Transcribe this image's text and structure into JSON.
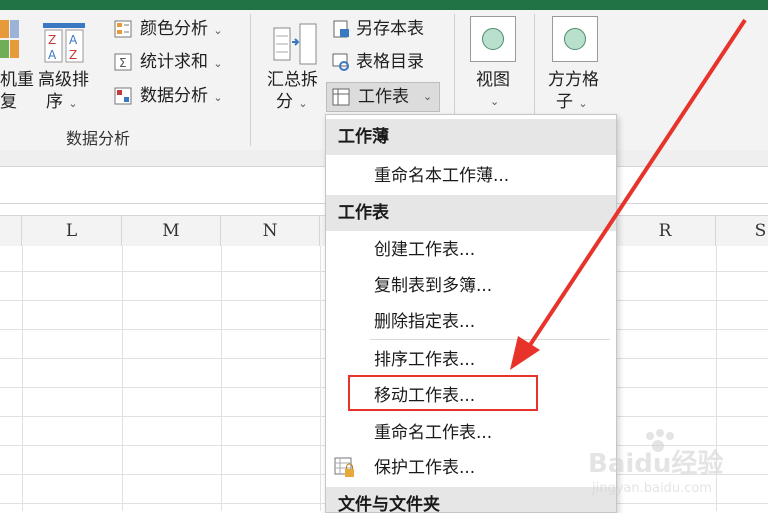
{
  "ribbon": {
    "left_cut_1": "机重",
    "left_cut_2": "复",
    "sort": {
      "line1": "高级排",
      "line2": "序"
    },
    "color_analysis": "颜色分析",
    "stat_sum": "统计求和",
    "data_analysis": "数据分析",
    "group_label": "数据分析",
    "summary_split": {
      "line1": "汇总拆",
      "line2": "分"
    },
    "save_copy": "另存本表",
    "table_dir": "表格目录",
    "worksheet": "工作表",
    "view": "视图",
    "fangfang": {
      "line1": "方方格",
      "line2": "子"
    }
  },
  "columns": [
    "L",
    "M",
    "N",
    "R",
    "S"
  ],
  "menu": {
    "section_workbook": "工作薄",
    "rename_workbook": "重命名本工作薄...",
    "section_worksheet": "工作表",
    "create_sheet": "创建工作表...",
    "copy_to_books": "复制表到多簿...",
    "delete_specified": "删除指定表...",
    "sort_sheets": "排序工作表...",
    "move_sheet": "移动工作表...",
    "rename_sheet": "重命名工作表...",
    "protect_sheet": "保护工作表...",
    "section_files": "文件与文件夹"
  },
  "watermark": {
    "logo": "Baidu经验",
    "url": "jingyan.baidu.com"
  },
  "colors": {
    "accent_green": "#217346",
    "highlight_red": "#e8332a"
  }
}
